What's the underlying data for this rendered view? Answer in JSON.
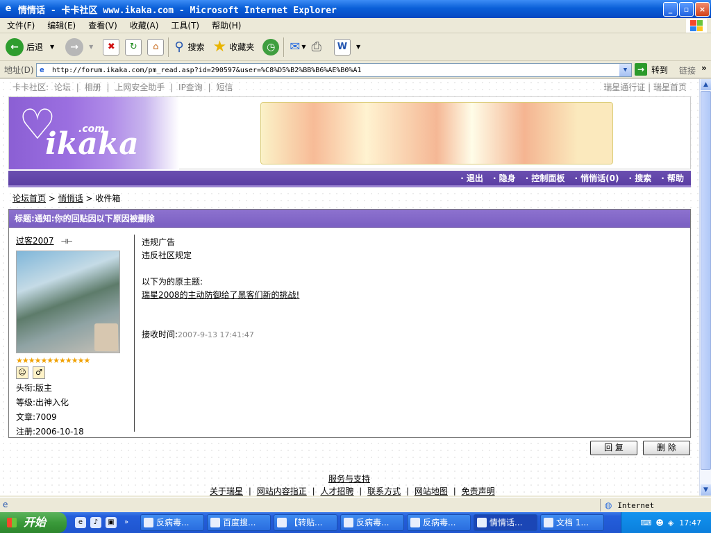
{
  "window": {
    "title": "情情话 - 卡卡社区 www.ikaka.com - Microsoft Internet Explorer"
  },
  "menu": [
    "文件(F)",
    "编辑(E)",
    "查看(V)",
    "收藏(A)",
    "工具(T)",
    "帮助(H)"
  ],
  "toolbar": {
    "back": "后退",
    "search": "搜索",
    "favorites": "收藏夹"
  },
  "address": {
    "label": "地址(D)",
    "url": "http://forum.ikaka.com/pm_read.asp?id=290597&user=%C8%D5%B2%BB%B6%AE%B0%A1",
    "go": "转到",
    "links": "链接"
  },
  "page": {
    "topnav": [
      "卡卡社区:",
      "论坛",
      "|",
      "相册",
      "|",
      "上网安全助手",
      "|",
      "IP查询",
      "|",
      "短信"
    ],
    "topright": [
      "瑞星通行证",
      "|",
      "瑞星首页"
    ],
    "logo": {
      "text": "ikaka",
      "com": ".com"
    },
    "navband": [
      "· 退出",
      "· 隐身",
      "· 控制面板",
      "· 悄悄话(0)",
      "· 搜索",
      "· 帮助"
    ],
    "crumb": {
      "home": "论坛首页",
      "sep1": " > ",
      "pm": "悄悄话",
      "sep2": " > ",
      "box": "收件箱"
    },
    "message_title": "标题:通知:你的回贴因以下原因被删除",
    "user": {
      "name": "过客2007",
      "stars": "★★★★★★★★★★★★",
      "title": "头衔:版主",
      "level": "等级:出神入化",
      "posts": "文章:7009",
      "reg": "注册:2006-10-18"
    },
    "body": {
      "line1": "违规广告",
      "line2": "违反社区规定",
      "line3": "以下为的原主题:",
      "link": "瑞星2008的主动防御给了黑客们新的挑战!",
      "recv_label": "接收时间:",
      "recv_time": "2007-9-13 17:41:47"
    },
    "buttons": {
      "reply": "回 复",
      "delete": "删 除"
    },
    "footer": {
      "service": "服务与支持",
      "links": [
        "关于瑞星",
        "|",
        "网站内容指正",
        "|",
        "人才招聘",
        "|",
        "联系方式",
        "|",
        "网站地图",
        "|",
        "免责声明"
      ]
    }
  },
  "status": {
    "zone": "Internet"
  },
  "taskbar": {
    "start": "开始",
    "tasks": [
      "反病毒...",
      "百度搜...",
      "【转贴...",
      "反病毒...",
      "反病毒...",
      "情情话...",
      "文档 1..."
    ],
    "clock": "17:47"
  }
}
